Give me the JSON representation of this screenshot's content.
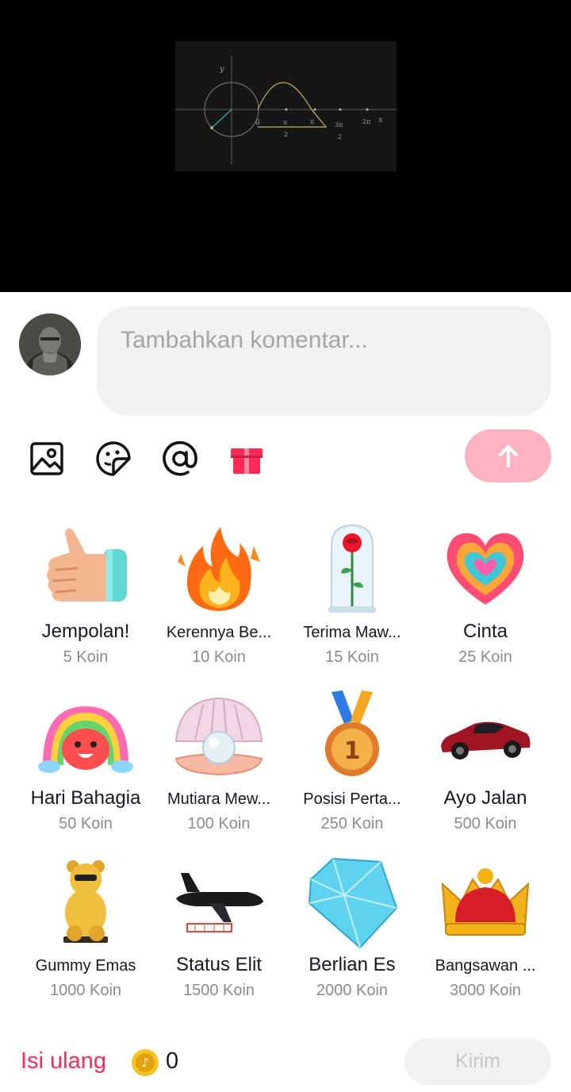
{
  "comment": {
    "placeholder": "Tambahkan komentar..."
  },
  "toolbar": {
    "icons": [
      "image-icon",
      "sticker-icon",
      "mention-icon",
      "gift-icon"
    ],
    "send_icon": "arrow-up-icon",
    "send_color": "#fdb3c1"
  },
  "video_graph": {
    "y_label": "y",
    "x_label": "x",
    "ticks": [
      "0",
      "π",
      "2",
      "π",
      "3π",
      "2",
      "2π"
    ]
  },
  "gifts": [
    {
      "name": "Jempolan!",
      "price": "5 Koin",
      "icon": "thumbs-up-icon"
    },
    {
      "name": "Kerennya Be...",
      "price": "10 Koin",
      "icon": "fire-icon"
    },
    {
      "name": "Terima Maw...",
      "price": "15 Koin",
      "icon": "rose-dome-icon"
    },
    {
      "name": "Cinta",
      "price": "25 Koin",
      "icon": "heart-icon"
    },
    {
      "name": "Hari Bahagia",
      "price": "50 Koin",
      "icon": "rainbow-icon"
    },
    {
      "name": "Mutiara Mew...",
      "price": "100 Koin",
      "icon": "pearl-shell-icon"
    },
    {
      "name": "Posisi Perta...",
      "price": "250 Koin",
      "icon": "medal-icon"
    },
    {
      "name": "Ayo Jalan",
      "price": "500 Koin",
      "icon": "sports-car-icon"
    },
    {
      "name": "Gummy Emas",
      "price": "1000 Koin",
      "icon": "gold-bear-icon"
    },
    {
      "name": "Status Elit",
      "price": "1500 Koin",
      "icon": "jet-icon"
    },
    {
      "name": "Berlian Es",
      "price": "2000 Koin",
      "icon": "diamond-icon"
    },
    {
      "name": "Bangsawan ...",
      "price": "3000 Koin",
      "icon": "crown-icon"
    }
  ],
  "footer": {
    "refill_label": "Isi ulang",
    "balance": "0",
    "send_label": "Kirim",
    "accent": "#fe2c55"
  }
}
